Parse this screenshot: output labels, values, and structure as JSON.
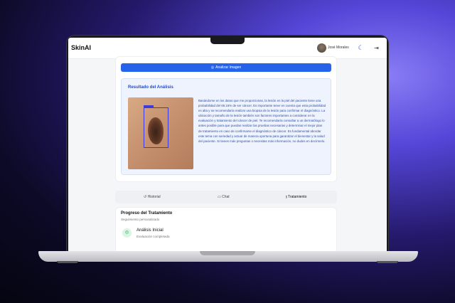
{
  "app": {
    "brand": "SkinAI",
    "user_name": "José Morales"
  },
  "icons": {
    "theme": "moon-icon",
    "logout": "logout-icon",
    "analyze": "camera-icon",
    "step": "camera-icon"
  },
  "colors": {
    "accent": "#2563eb",
    "result_bg": "#eef3fd",
    "result_text": "#2d4fa8",
    "success": "#16a34a"
  },
  "analysis": {
    "button_label": "Analizar Imagen",
    "result_title": "Resultado del Análisis",
    "result_text": "Basándome en los datos que me proporcionas, la lesión en la piel del paciente tiene una probabilidad del 69.15% de ser cáncer. Es importante tener en cuenta que esta probabilidad es alta y se recomendaría realizar una biopsia de la lesión para confirmar el diagnóstico. La ubicación y tamaño de la lesión también son factores importantes a considerar en la evaluación y tratamiento del cáncer de piel. Te recomendaría consultar a un dermatólogo lo antes posible para que puedan realizar las pruebas necesarias y determinar el mejor plan de tratamiento en caso de confirmarse el diagnóstico de cáncer. Es fundamental abordar este tema con seriedad y actuar de manera oportuna para garantizar el bienestar y la salud del paciente. Si tienes más preguntas o necesitas más información, no dudes en decírmelo."
  },
  "tabs": [
    {
      "label": "Historial",
      "icon": "history-icon"
    },
    {
      "label": "Chat",
      "icon": "chat-icon"
    },
    {
      "label": "Tratamiento",
      "icon": "chart-icon"
    }
  ],
  "progress": {
    "title": "Progreso del Tratamiento",
    "subtitle": "Seguimiento personalizado",
    "steps": [
      {
        "label": "Análisis Inicial",
        "status": "Evaluación completada"
      }
    ]
  }
}
